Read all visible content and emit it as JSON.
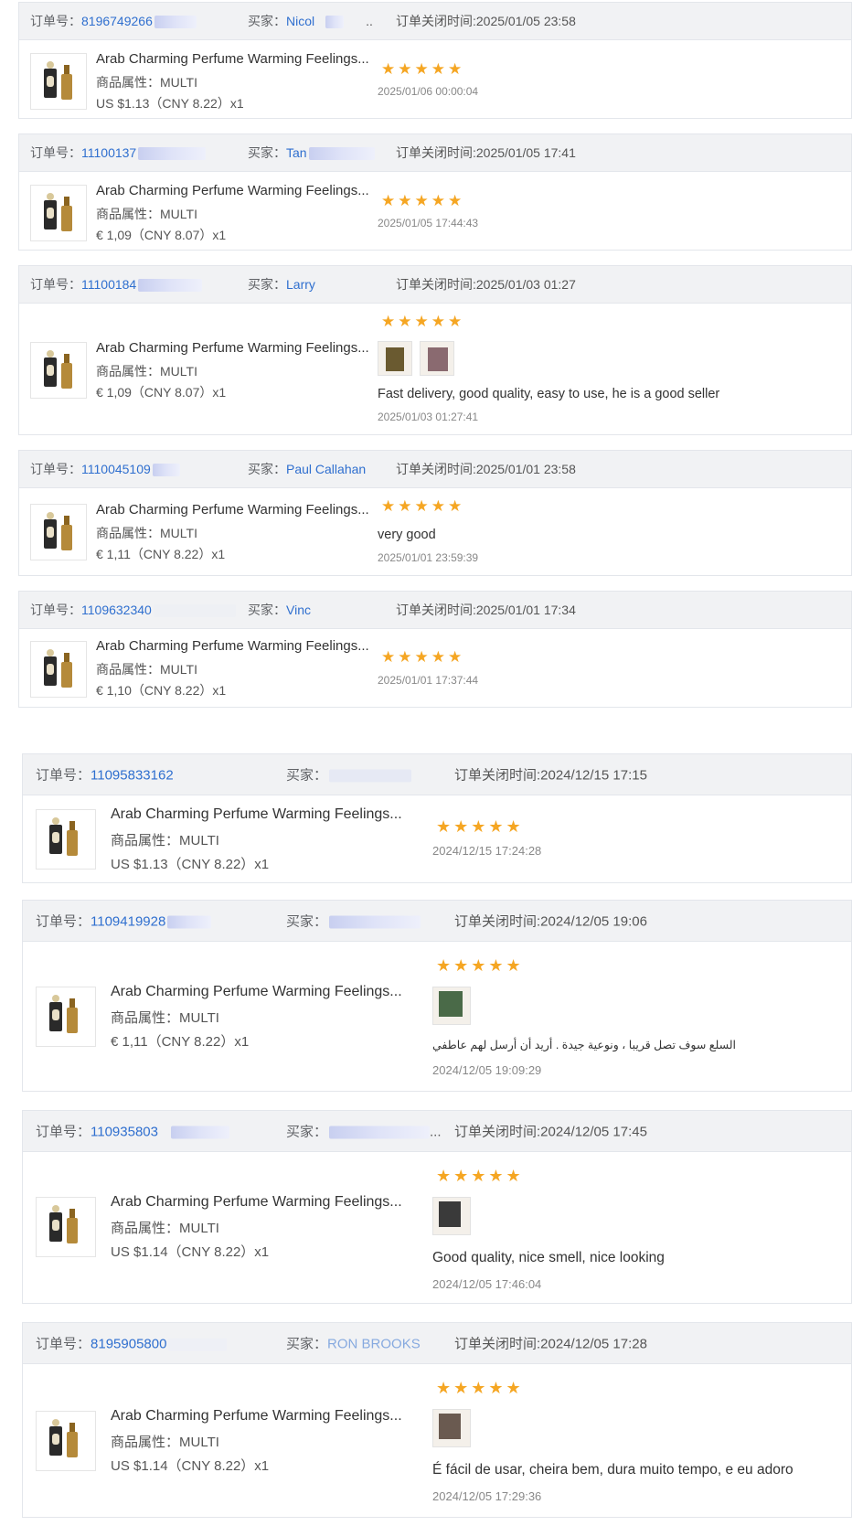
{
  "labels": {
    "order_no": "订单号：",
    "buyer": "买家：",
    "close_time": "订单关闭时间:",
    "attr": "商品属性：",
    "stars": "★★★★★"
  },
  "orders": [
    {
      "order_no": "8196749266",
      "buyer": "Nicol",
      "buyer_tail": "..",
      "close_time": "2025/01/05 23:58",
      "title": "Arab Charming Perfume Warming Feelings...",
      "attr": "MULTI",
      "price": "US $1.13（CNY  8.22）x1",
      "review_date": "2025/01/06 00:00:04",
      "review_text": "",
      "images": []
    },
    {
      "order_no": "11100137",
      "buyer": "Tan",
      "buyer_tail": "",
      "close_time": "2025/01/05 17:41",
      "title": "Arab Charming Perfume Warming Feelings...",
      "attr": "MULTI",
      "price": "€ 1,09（CNY  8.07）x1",
      "review_date": "2025/01/05 17:44:43",
      "review_text": "",
      "images": []
    },
    {
      "order_no": "11100184",
      "buyer": "Larry",
      "buyer_tail": "",
      "close_time": "2025/01/03 01:27",
      "title": "Arab Charming Perfume Warming Feelings...",
      "attr": "MULTI",
      "price": "€ 1,09（CNY  8.07）x1",
      "review_date": "2025/01/03 01:27:41",
      "review_text": "Fast delivery, good quality, easy to use, he is a good seller",
      "images": [
        "p1",
        "p2"
      ]
    },
    {
      "order_no": "1110045109",
      "buyer": "Paul Callahan",
      "buyer_tail": "",
      "close_time": "2025/01/01 23:58",
      "title": "Arab Charming Perfume Warming Feelings...",
      "attr": "MULTI",
      "price": "€ 1,11（CNY  8.22）x1",
      "review_date": "2025/01/01 23:59:39",
      "review_text": "very good",
      "images": []
    },
    {
      "order_no": "1109632340",
      "buyer": "Vinc",
      "buyer_tail": "",
      "close_time": "2025/01/01 17:34",
      "title": "Arab Charming Perfume Warming Feelings...",
      "attr": "MULTI",
      "price": "€ 1,10（CNY  8.22）x1",
      "review_date": "2025/01/01 17:37:44",
      "review_text": "",
      "images": []
    },
    {
      "order_no": "11095833162",
      "buyer": "",
      "buyer_tail": "",
      "close_time": "2024/12/15 17:15",
      "title": "Arab Charming Perfume Warming Feelings...",
      "attr": "MULTI",
      "price": "US $1.13（CNY  8.22）x1",
      "review_date": "2024/12/15 17:24:28",
      "review_text": "",
      "images": []
    },
    {
      "order_no": "1109419928",
      "buyer": "",
      "buyer_tail": "",
      "close_time": "2024/12/05 19:06",
      "title": "Arab Charming Perfume Warming Feelings...",
      "attr": "MULTI",
      "price": "€ 1,11（CNY  8.22）x1",
      "review_date": "2024/12/05 19:09:29",
      "review_text": "السلع سوف تصل قريبا ، ونوعية جيدة . أريد أن أرسل لهم عاطفي",
      "images": [
        "p3"
      ]
    },
    {
      "order_no": "110935803",
      "buyer": "",
      "buyer_tail": "...",
      "close_time": "2024/12/05 17:45",
      "title": "Arab Charming Perfume Warming Feelings...",
      "attr": "MULTI",
      "price": "US $1.14（CNY  8.22）x1",
      "review_date": "2024/12/05 17:46:04",
      "review_text": "Good quality, nice smell, nice looking",
      "images": [
        "p4"
      ]
    },
    {
      "order_no": "8195905800",
      "buyer": "RON BROOKS",
      "buyer_tail": "",
      "close_time": "2024/12/05 17:28",
      "title": "Arab Charming Perfume Warming Feelings...",
      "attr": "MULTI",
      "price": "US $1.14（CNY  8.22）x1",
      "review_date": "2024/12/05 17:29:36",
      "review_text": "É fácil de usar, cheira bem, dura muito tempo, e eu adoro",
      "images": [
        "p5"
      ]
    }
  ]
}
